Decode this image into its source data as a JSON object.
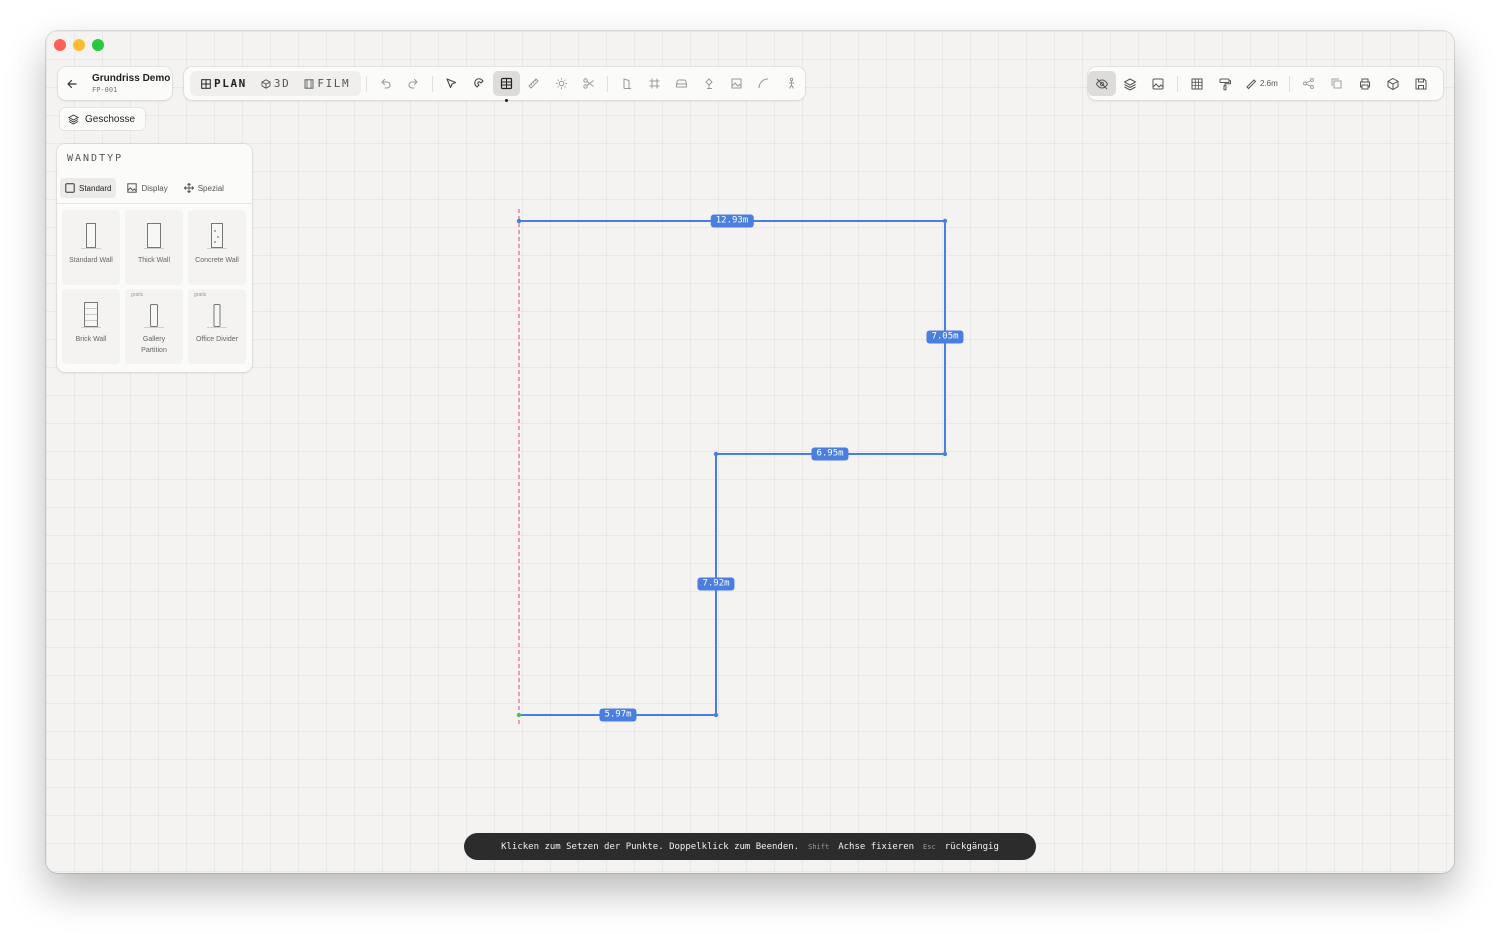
{
  "window": {
    "title": "Grundriss Demo"
  },
  "project": {
    "title": "Grundriss Demo",
    "id": "FP-001"
  },
  "modes": [
    {
      "label": "PLAN",
      "icon": "grid-icon",
      "active": true
    },
    {
      "label": "3D",
      "icon": "cube-icon",
      "active": false
    },
    {
      "label": "FILM",
      "icon": "film-icon",
      "active": false
    }
  ],
  "floors": {
    "label": "Geschosse"
  },
  "status": {
    "wall_height": "2.6m"
  },
  "walltype": {
    "title": "WANDTYP",
    "tabs": [
      {
        "label": "Standard",
        "active": true
      },
      {
        "label": "Display",
        "active": false
      },
      {
        "label": "Spezial",
        "active": false
      }
    ],
    "items": [
      {
        "label": "Standard Wall",
        "badge": ""
      },
      {
        "label": "Thick Wall",
        "badge": ""
      },
      {
        "label": "Concrete Wall",
        "badge": ""
      },
      {
        "label": "Brick Wall",
        "badge": ""
      },
      {
        "label": "Gallery Partition",
        "badge": "gratis"
      },
      {
        "label": "Office Divider",
        "badge": "gratis"
      }
    ]
  },
  "walls": [
    {
      "length": "12.93m"
    },
    {
      "length": "7.05m"
    },
    {
      "length": "6.95m"
    },
    {
      "length": "7.92m"
    },
    {
      "length": "5.97m"
    }
  ],
  "hint": {
    "instruction": "Klicken zum Setzen der Punkte. Doppelklick zum Beenden.",
    "shift_key": "Shift",
    "shift_action": "Achse fixieren",
    "esc_key": "Esc",
    "esc_action": "rückgängig"
  },
  "colors": {
    "accent": "#4a7fe0",
    "guide": "#e0457a",
    "canvas": "#f4f3f2"
  }
}
